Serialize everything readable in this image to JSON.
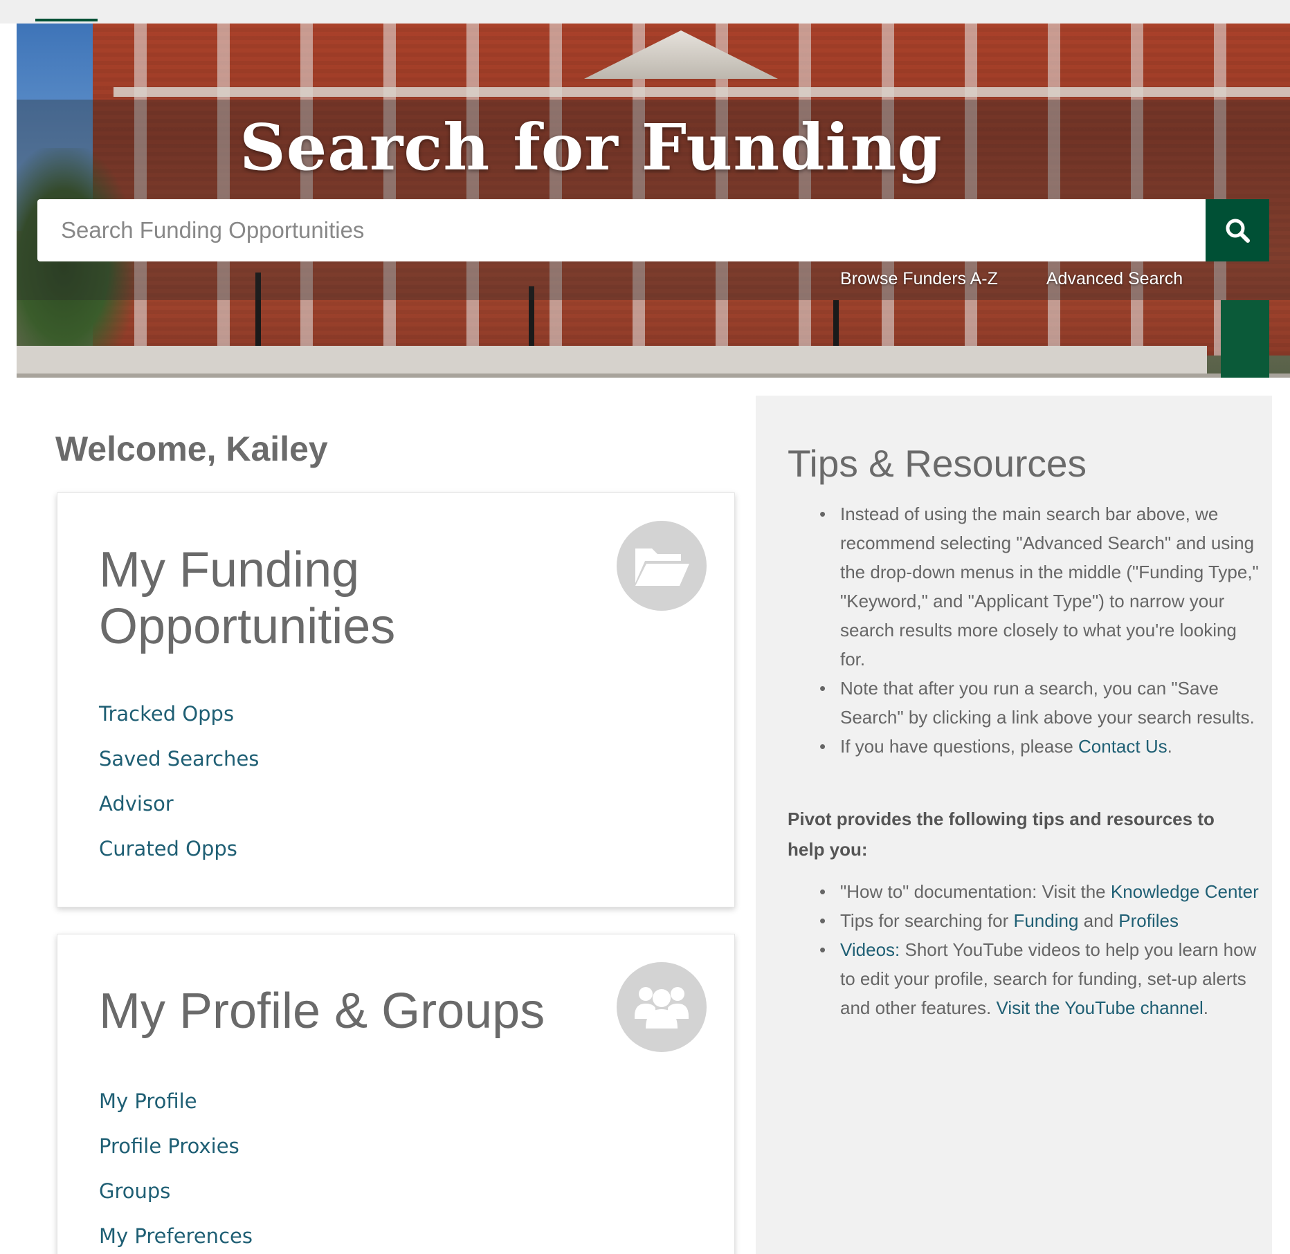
{
  "hero": {
    "title": "Search for Funding",
    "search_placeholder": "Search Funding Opportunities",
    "browse_link": "Browse Funders A-Z",
    "advanced_link": "Advanced Search"
  },
  "welcome": "Welcome, Kailey",
  "funding_card": {
    "title_line1": "My Funding",
    "title_line2": "Opportunities",
    "links": [
      "Tracked Opps",
      "Saved Searches",
      "Advisor",
      "Curated Opps"
    ]
  },
  "profile_card": {
    "title": "My Profile & Groups",
    "links": [
      "My Profile",
      "Profile Proxies",
      "Groups",
      "My Preferences"
    ]
  },
  "tips": {
    "heading": "Tips & Resources",
    "bullets": [
      "Instead of using the main search bar above, we recommend selecting \"Advanced Search\" and using the drop-down menus in the middle (\"Funding Type,\" \"Keyword,\" and \"Applicant Type\") to narrow your search results more closely to what you're looking for.",
      "Note that after you run a search, you can \"Save Search\" by clicking a link above your search results.",
      "If you have questions, please "
    ],
    "contact_link": "Contact Us",
    "contact_suffix": ".",
    "pivot_text": "Pivot provides the following tips and resources to help you:",
    "howto_prefix": "\"How to\" documentation: Visit the ",
    "knowledge_link": "Knowledge Center",
    "searching_prefix": "Tips for searching for ",
    "funding_link": "Funding",
    "and_text": " and ",
    "profiles_link": "Profiles",
    "videos_link": "Videos:",
    "videos_text": " Short YouTube videos to help you learn how to edit your profile, search for funding, set-up alerts and other features. ",
    "youtube_link": "Visit the YouTube channel",
    "youtube_suffix": "."
  },
  "colors": {
    "brand_green": "#005035",
    "link_teal": "#1f5f74"
  },
  "icons": [
    "search-icon",
    "folder-open-icon",
    "users-icon"
  ]
}
